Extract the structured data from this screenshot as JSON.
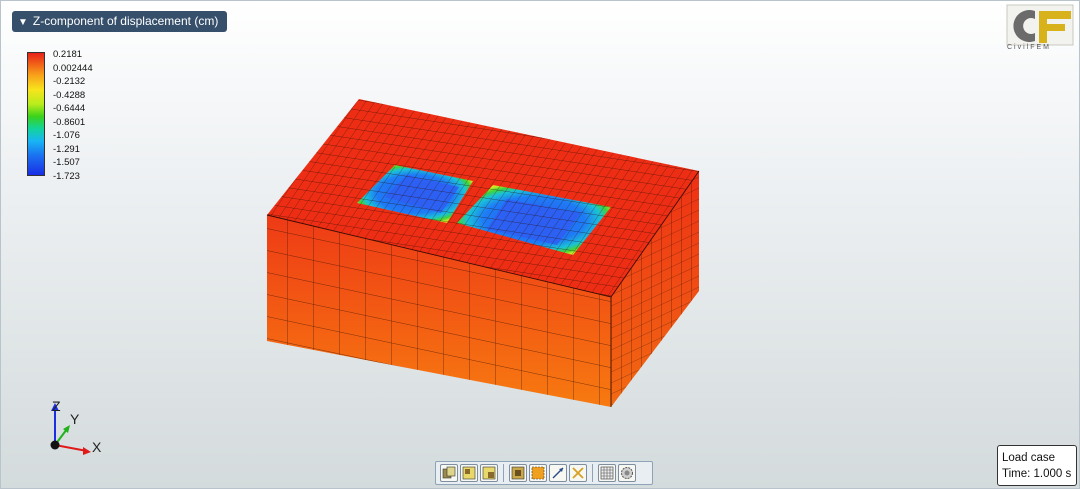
{
  "result": {
    "title": "Z-component of displacement (cm)",
    "toggle_icon": "triangle-down-icon"
  },
  "legend": {
    "labels": [
      "0.2181",
      "0.002444",
      "-0.2132",
      "-0.4288",
      "-0.6444",
      "-0.8601",
      "-1.076",
      "-1.291",
      "-1.507",
      "-1.723"
    ],
    "colors": [
      "#e8201a",
      "#f05a18",
      "#f8a01a",
      "#f8e41c",
      "#b8ec1c",
      "#3ad21a",
      "#12d49a",
      "#18b6f4",
      "#1a72f0",
      "#1a2ee6"
    ]
  },
  "logo": {
    "mark": "CF",
    "text": "CivilFEM",
    "color": "#d8b21a"
  },
  "axes": {
    "z": "Z",
    "y": "Y",
    "x": "X"
  },
  "toolbar": {
    "buttons": [
      "view-front-icon",
      "view-side-icon",
      "view-iso-icon",
      "select-box-icon",
      "measure-icon",
      "fit-icon",
      "mesh-grid-icon",
      "settings-icon"
    ]
  },
  "info": {
    "line1": "Load case",
    "line2": "Time: 1.000 s"
  }
}
